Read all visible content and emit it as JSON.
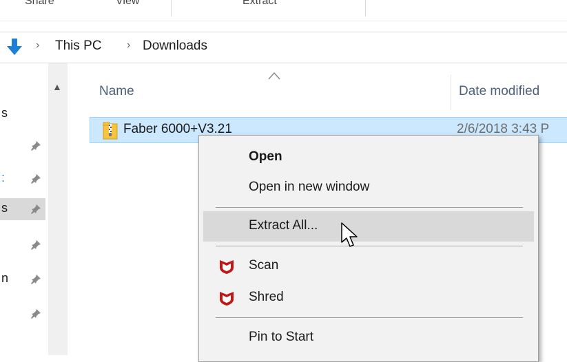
{
  "ribbon": {
    "tabs": [
      "Share",
      "View",
      "Extract"
    ]
  },
  "address": {
    "crumbs": [
      "This PC",
      "Downloads"
    ],
    "separator": "›"
  },
  "nav": {
    "items": [
      {
        "fragment": "s",
        "blue": false,
        "pinned": false
      },
      {
        "fragment": "",
        "blue": false,
        "pinned": true
      },
      {
        "fragment": ":",
        "blue": true,
        "pinned": true
      },
      {
        "fragment": "s",
        "blue": false,
        "pinned": true
      },
      {
        "fragment": "",
        "blue": false,
        "pinned": true
      },
      {
        "fragment": "n",
        "blue": false,
        "pinned": true
      },
      {
        "fragment": "",
        "blue": false,
        "pinned": true
      }
    ]
  },
  "columns": {
    "name": "Name",
    "date_modified": "Date modified"
  },
  "file": {
    "name": "Faber 6000+V3.21",
    "date": "2/6/2018 3:43 P",
    "icon": "zip-folder-icon"
  },
  "context_menu": {
    "open": "Open",
    "open_new_window": "Open in new window",
    "extract_all": "Extract All...",
    "scan": "Scan",
    "shred": "Shred",
    "pin_to_start": "Pin to Start"
  },
  "colors": {
    "selection_bg": "#cce8ff",
    "selection_border": "#99d1ff",
    "menu_bg": "#f2f2f2",
    "menu_highlight": "#d9d9d9",
    "mcafee_red": "#c01818",
    "header_text": "#4c607a"
  }
}
